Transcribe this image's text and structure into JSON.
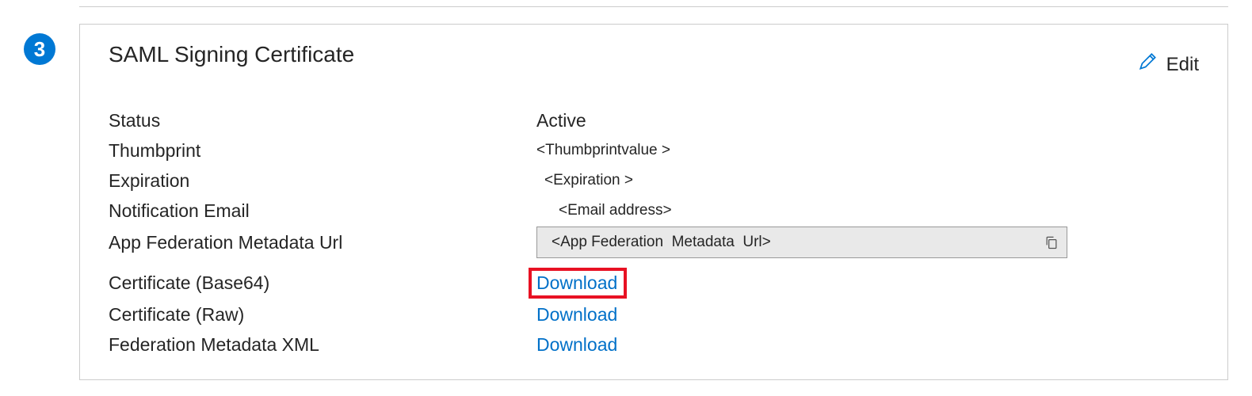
{
  "step": "3",
  "card": {
    "title": "SAML Signing Certificate",
    "edit_label": "Edit"
  },
  "rows": {
    "status": {
      "label": "Status",
      "value": "Active"
    },
    "thumbprint": {
      "label": "Thumbprint",
      "value": "<Thumbprintvalue >"
    },
    "expiration": {
      "label": "Expiration",
      "value": "<Expiration >"
    },
    "notification_email": {
      "label": "Notification Email",
      "value": "<Email address>"
    },
    "metadata_url": {
      "label": "App Federation Metadata Url",
      "value": "<App Federation  Metadata  Url>"
    },
    "cert_base64": {
      "label": "Certificate (Base64)",
      "link": "Download"
    },
    "cert_raw": {
      "label": "Certificate (Raw)",
      "link": "Download"
    },
    "fed_xml": {
      "label": "Federation Metadata XML",
      "link": "Download"
    }
  }
}
